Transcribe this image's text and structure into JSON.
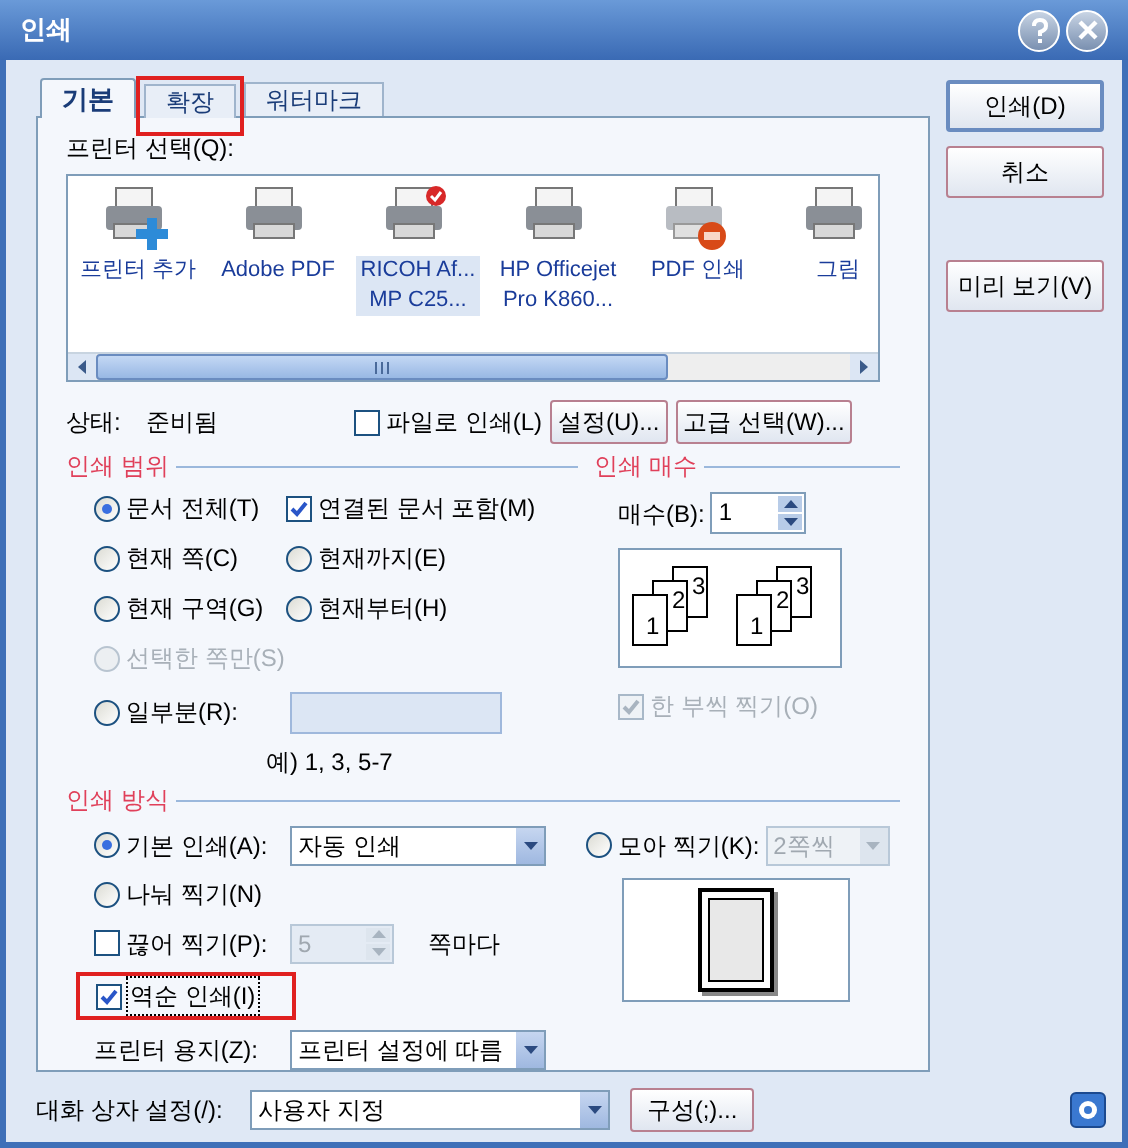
{
  "window": {
    "title": "인쇄"
  },
  "tabs": [
    {
      "label": "기본",
      "selected": true,
      "highlighted": false
    },
    {
      "label": "확장",
      "selected": false,
      "highlighted": true
    },
    {
      "label": "워터마크",
      "selected": false,
      "highlighted": false
    }
  ],
  "printer_select": {
    "label": "프린터 선택(Q):",
    "printers": [
      {
        "name": [
          "프린터 추가"
        ],
        "kind": "add",
        "selected": false
      },
      {
        "name": [
          "Adobe PDF"
        ],
        "kind": "plain",
        "selected": false
      },
      {
        "name": [
          "RICOH Af...",
          "MP C25..."
        ],
        "kind": "default",
        "selected": true
      },
      {
        "name": [
          "HP Officejet",
          "Pro K860..."
        ],
        "kind": "plain",
        "selected": false
      },
      {
        "name": [
          "PDF 인쇄"
        ],
        "kind": "pdf",
        "selected": false
      },
      {
        "name": [
          "그림"
        ],
        "kind": "plain",
        "selected": false
      }
    ]
  },
  "status": {
    "label": "상태:",
    "value": "준비됨",
    "print_to_file": {
      "label": "파일로 인쇄(L)",
      "checked": false
    },
    "buttons": [
      "설정(U)...",
      "고급 선택(W)..."
    ]
  },
  "print_range": {
    "title": "인쇄 범위",
    "options": [
      {
        "label": "문서 전체(T)",
        "selected": true,
        "disabled": false
      },
      {
        "label": "현재 쪽(C)",
        "selected": false,
        "disabled": false
      },
      {
        "label": "현재까지(E)",
        "selected": false,
        "disabled": false
      },
      {
        "label": "현재 구역(G)",
        "selected": false,
        "disabled": false
      },
      {
        "label": "현재부터(H)",
        "selected": false,
        "disabled": false
      },
      {
        "label": "선택한 쪽만(S)",
        "selected": false,
        "disabled": true
      },
      {
        "label": "일부분(R):",
        "selected": false,
        "disabled": false
      }
    ],
    "linked_docs": {
      "label": "연결된 문서 포함(M)",
      "checked": true
    },
    "hint": "예) 1, 3, 5-7"
  },
  "copies": {
    "title": "인쇄 매수",
    "label": "매수(B):",
    "value": "1",
    "collate_stacks": [
      [
        "1",
        "2",
        "3"
      ],
      [
        "1",
        "2",
        "3"
      ]
    ],
    "collate": {
      "label": "한 부씩 찍기(O)",
      "checked": true,
      "disabled": true
    }
  },
  "print_mode": {
    "title": "인쇄 방식",
    "modes": [
      {
        "label": "기본 인쇄(A):",
        "selected": true
      },
      {
        "label": "모아 찍기(K):",
        "selected": false
      },
      {
        "label": "나눠 찍기(N)",
        "selected": false
      }
    ],
    "basic_select": "자동 인쇄",
    "nup_select": {
      "value": "2쪽씩",
      "disabled": true
    },
    "split": {
      "label": "끊어 찍기(P):",
      "checked": false,
      "value": "5",
      "disabled": true,
      "suffix": "쪽마다"
    },
    "reverse": {
      "label": "역순 인쇄(I)",
      "checked": true,
      "highlighted": true,
      "focused": true
    },
    "paper": {
      "label": "프린터 용지(Z):",
      "value": "프린터 설정에 따름"
    }
  },
  "dialog_settings": {
    "label": "대화 상자 설정(/):",
    "value": "사용자 지정",
    "button": "구성(;)..."
  },
  "side_buttons": [
    {
      "label": "인쇄(D)",
      "default": true
    },
    {
      "label": "취소",
      "default": false
    },
    {
      "label": "미리 보기(V)",
      "default": false
    }
  ]
}
